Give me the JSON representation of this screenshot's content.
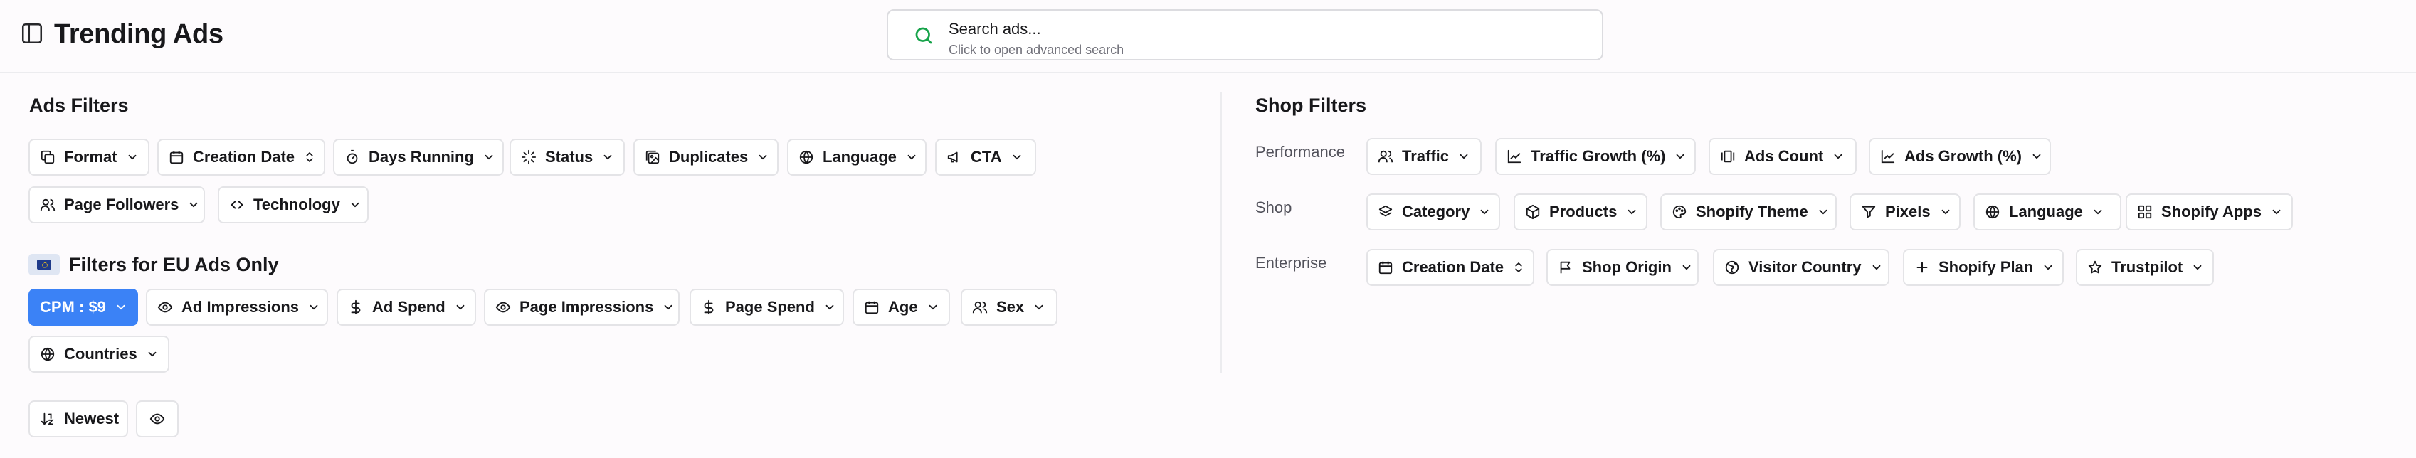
{
  "header": {
    "title": "Trending Ads",
    "search": {
      "label": "Search ads...",
      "hint": "Click to open advanced search"
    }
  },
  "ads_filters": {
    "title": "Ads Filters",
    "chips": [
      "Format",
      "Creation Date",
      "Days Running",
      "Status",
      "Duplicates",
      "Language",
      "CTA",
      "Page Followers",
      "Technology"
    ]
  },
  "eu_filters": {
    "title": "Filters for EU Ads Only",
    "chips": [
      "CPM : $9",
      "Ad Impressions",
      "Ad Spend",
      "Page Impressions",
      "Page Spend",
      "Age",
      "Sex",
      "Countries"
    ]
  },
  "sort": {
    "label": "Newest"
  },
  "shop_filters": {
    "title": "Shop Filters",
    "rows": [
      {
        "label": "Performance",
        "chips": [
          "Traffic",
          "Traffic Growth (%)",
          "Ads Count",
          "Ads Growth (%)"
        ]
      },
      {
        "label": "Shop",
        "chips": [
          "Category",
          "Products",
          "Shopify Theme",
          "Pixels",
          "Language",
          "Shopify Apps"
        ]
      },
      {
        "label": "Enterprise",
        "chips": [
          "Creation Date",
          "Shop Origin",
          "Visitor Country",
          "Shopify Plan",
          "Trustpilot"
        ]
      }
    ]
  },
  "colors": {
    "accent": "#3b82f6",
    "search_icon": "#16a34a"
  }
}
